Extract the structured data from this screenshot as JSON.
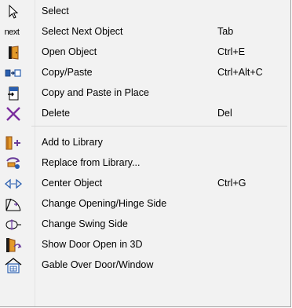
{
  "menu": {
    "items": [
      {
        "label": "Select",
        "shortcut": "",
        "icon": "arrow-cursor-icon"
      },
      {
        "label": "Select Next Object",
        "shortcut": "Tab",
        "icon": "next-icon",
        "icon_text": "next"
      },
      {
        "label": "Open Object",
        "shortcut": "Ctrl+E",
        "icon": "open-object-icon"
      },
      {
        "label": "Copy/Paste",
        "shortcut": "Ctrl+Alt+C",
        "icon": "copy-paste-icon"
      },
      {
        "label": "Copy and Paste in Place",
        "shortcut": "",
        "icon": "paste-in-place-icon"
      },
      {
        "label": "Delete",
        "shortcut": "Del",
        "icon": "delete-x-icon"
      },
      {
        "label": "Add to Library",
        "shortcut": "",
        "icon": "add-to-library-icon"
      },
      {
        "label": "Replace from Library...",
        "shortcut": "",
        "icon": "replace-from-library-icon"
      },
      {
        "label": "Center Object",
        "shortcut": "Ctrl+G",
        "icon": "center-object-icon"
      },
      {
        "label": "Change Opening/Hinge Side",
        "shortcut": "",
        "icon": "change-hinge-side-icon"
      },
      {
        "label": "Change Swing Side",
        "shortcut": "",
        "icon": "change-swing-side-icon"
      },
      {
        "label": "Show Door Open in 3D",
        "shortcut": "",
        "icon": "door-open-3d-icon"
      },
      {
        "label": "Gable Over Door/Window",
        "shortcut": "",
        "icon": "gable-over-door-icon"
      }
    ]
  },
  "colors": {
    "menu_bg": "#f2f2f2",
    "separator": "#d7d7d7",
    "delete_x": "#7b2d9e",
    "door_brown": "#8a4a14",
    "door_orange": "#e49a2a",
    "blue": "#2a5fb0",
    "purple": "#6a3d9a"
  }
}
